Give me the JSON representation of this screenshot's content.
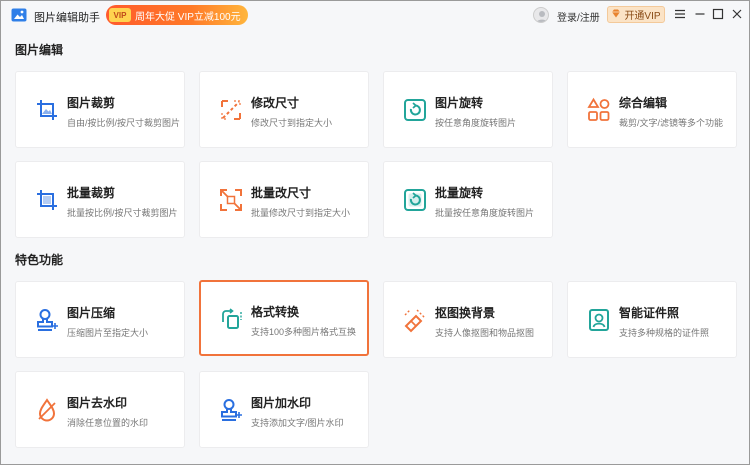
{
  "app": {
    "title": "图片编辑助手",
    "promo_badge": "VIP",
    "promo_text": "周年大促 VIP立减100元",
    "login": "登录/注册",
    "vip_button": "开通VIP"
  },
  "sections": {
    "edit": "图片编辑",
    "special": "特色功能"
  },
  "cards": {
    "crop": {
      "title": "图片裁剪",
      "desc": "自由/按比例/按尺寸裁剪图片"
    },
    "resize": {
      "title": "修改尺寸",
      "desc": "修改尺寸到指定大小"
    },
    "rotate": {
      "title": "图片旋转",
      "desc": "按任意角度旋转图片"
    },
    "combo": {
      "title": "综合编辑",
      "desc": "裁剪/文字/滤镜等多个功能"
    },
    "batch_crop": {
      "title": "批量裁剪",
      "desc": "批量按比例/按尺寸裁剪图片"
    },
    "batch_resize": {
      "title": "批量改尺寸",
      "desc": "批量修改尺寸到指定大小"
    },
    "batch_rotate": {
      "title": "批量旋转",
      "desc": "批量按任意角度旋转图片"
    },
    "compress": {
      "title": "图片压缩",
      "desc": "压缩图片至指定大小"
    },
    "convert": {
      "title": "格式转换",
      "desc": "支持100多种图片格式互换"
    },
    "cutout": {
      "title": "抠图换背景",
      "desc": "支持人像抠图和物品抠图"
    },
    "idphoto": {
      "title": "智能证件照",
      "desc": "支持多种规格的证件照"
    },
    "remove_wm": {
      "title": "图片去水印",
      "desc": "消除任意位置的水印"
    },
    "add_wm": {
      "title": "图片加水印",
      "desc": "支持添加文字/图片水印"
    }
  },
  "colors": {
    "blue": "#2a6fe0",
    "orange": "#f1733b",
    "teal": "#22a59a",
    "active_border": "#f1733b"
  }
}
